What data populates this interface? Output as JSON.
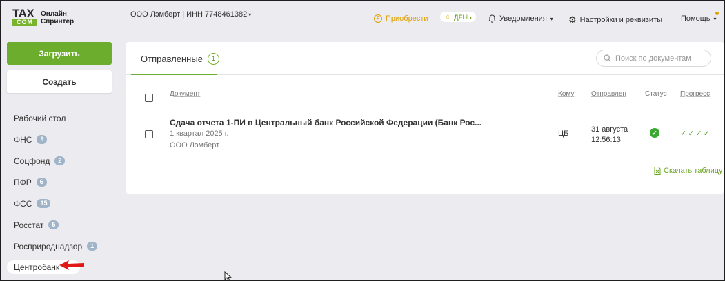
{
  "header": {
    "logo_tax": "TAX",
    "logo_com": "COM",
    "logo_product": "Онлайн Спринтер",
    "org": "ООО Лэмберт | ИНН 7748461382",
    "buy_label": "Приобрести",
    "day_label": "ДЕНЬ",
    "notifications_label": "Уведомления",
    "settings_label": "Настройки и реквизиты",
    "help_label": "Помощь"
  },
  "sidebar": {
    "upload_label": "Загрузить",
    "create_label": "Создать",
    "items": [
      {
        "label": "Рабочий стол",
        "badge": ""
      },
      {
        "label": "ФНС",
        "badge": "9"
      },
      {
        "label": "Соцфонд",
        "badge": "2"
      },
      {
        "label": "ПФР",
        "badge": "6"
      },
      {
        "label": "ФСС",
        "badge": "15"
      },
      {
        "label": "Росстат",
        "badge": "5"
      },
      {
        "label": "Росприроднадзор",
        "badge": "1"
      },
      {
        "label": "Центробанк",
        "badge": ""
      }
    ]
  },
  "main": {
    "tab_label": "Отправленные",
    "tab_count": "1",
    "search_placeholder": "Поиск по документам",
    "columns": {
      "document": "Документ",
      "to": "Кому",
      "sent": "Отправлен",
      "status": "Статус",
      "progress": "Прогресс"
    },
    "rows": [
      {
        "title": "Сдача отчета 1-ПИ в Центральный банк Российской Федерации (Банк Рос...",
        "period": "1 квартал 2025 г.",
        "org": "ООО Лэмберт",
        "to": "ЦБ",
        "date": "31 августа",
        "time": "12:56:13",
        "status_icon": "✓",
        "progress": "✓✓✓✓"
      }
    ],
    "download_label": "Скачать таблицу"
  },
  "colors": {
    "accent_green": "#6cad2d",
    "gold": "#e0a000",
    "badge_gray": "#9fb4c9",
    "status_green": "#3aa832"
  }
}
